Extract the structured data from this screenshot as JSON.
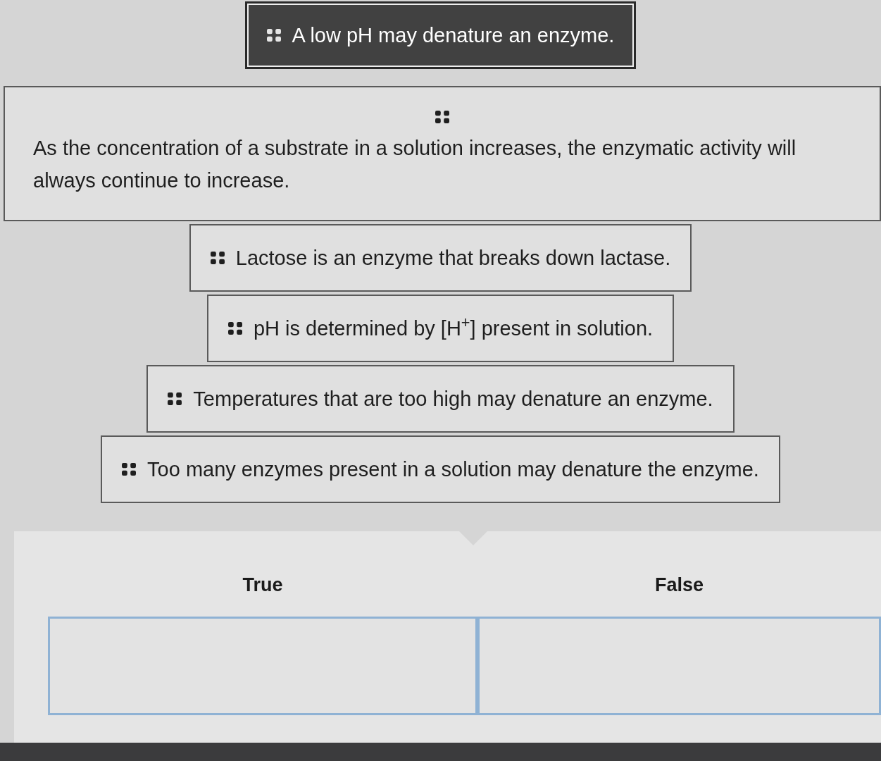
{
  "cards": [
    {
      "kind": "inline",
      "text": "A low pH may denature an enzyme.",
      "selected": true
    },
    {
      "kind": "stacked",
      "text": "As the concentration of a substrate in a solution increases, the enzymatic activity will always continue to increase.",
      "selected": false
    },
    {
      "kind": "inline",
      "text": "Lactose is an enzyme that breaks down lactase.",
      "selected": false
    },
    {
      "kind": "inline",
      "text": "pH is determined by [H$^{+}$] present in solution.",
      "selected": false
    },
    {
      "kind": "inline",
      "text": "Temperatures that are too high may denature an enzyme.",
      "selected": false
    },
    {
      "kind": "inline",
      "text": "Too many enzymes present in a solution may denature the enzyme.",
      "selected": false
    }
  ],
  "categories": [
    {
      "label": "True"
    },
    {
      "label": "False"
    }
  ]
}
